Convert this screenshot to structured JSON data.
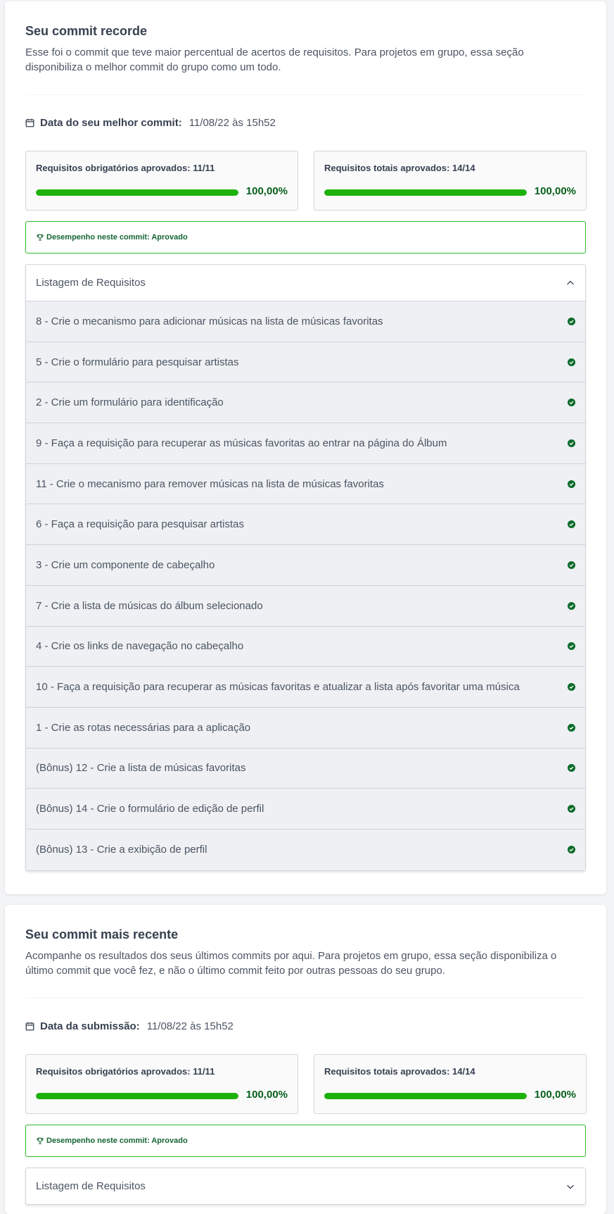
{
  "colors": {
    "progress": "#1db10b",
    "approved_border": "#2dbb27",
    "percent_text": "#065f1b",
    "check": "#0b6b2a"
  },
  "best_commit": {
    "title": "Seu commit recorde",
    "description": "Esse foi o commit que teve maior percentual de acertos de requisitos. Para projetos em grupo, essa seção disponibiliza o melhor commit do grupo como um todo.",
    "date_icon": "calendar-icon",
    "date_label": "Data do seu melhor commit:",
    "date_value": "11/08/22 às 15h52",
    "mandatory": {
      "label": "Requisitos obrigatórios aprovados: 11/11",
      "percent_text": "100,00%",
      "progress": 1.0
    },
    "total": {
      "label": "Requisitos totais aprovados: 14/14",
      "percent_text": "100,00%",
      "progress": 1.0
    },
    "performance_icon": "trophy-icon",
    "performance": "Desempenho neste commit: Aprovado",
    "requirements_header": "Listagem de Requisitos",
    "requirements_expanded": true,
    "requirements": [
      "8 - Crie o mecanismo para adicionar músicas na lista de músicas favoritas",
      "5 - Crie o formulário para pesquisar artistas",
      "2 - Crie um formulário para identificação",
      "9 - Faça a requisição para recuperar as músicas favoritas ao entrar na página do Álbum",
      "11 - Crie o mecanismo para remover músicas na lista de músicas favoritas",
      "6 - Faça a requisição para pesquisar artistas",
      "3 - Crie um componente de cabeçalho",
      "7 - Crie a lista de músicas do álbum selecionado",
      "4 - Crie os links de navegação no cabeçalho",
      "10 - Faça a requisição para recuperar as músicas favoritas e atualizar a lista após favoritar uma música",
      "1 - Crie as rotas necessárias para a aplicação",
      "(Bônus) 12 - Crie a lista de músicas favoritas",
      "(Bônus) 14 - Crie o formulário de edição de perfil",
      "(Bônus) 13 - Crie a exibição de perfil"
    ]
  },
  "latest_commit": {
    "title": "Seu commit mais recente",
    "description": "Acompanhe os resultados dos seus últimos commits por aqui. Para projetos em grupo, essa seção disponibiliza o último commit que você fez, e não o último commit feito por outras pessoas do seu grupo.",
    "date_icon": "calendar-icon",
    "date_label": "Data da submissão:",
    "date_value": "11/08/22 às 15h52",
    "mandatory": {
      "label": "Requisitos obrigatórios aprovados: 11/11",
      "percent_text": "100,00%",
      "progress": 1.0
    },
    "total": {
      "label": "Requisitos totais aprovados: 14/14",
      "percent_text": "100,00%",
      "progress": 1.0
    },
    "performance_icon": "trophy-icon",
    "performance": "Desempenho neste commit: Aprovado",
    "requirements_header": "Listagem de Requisitos",
    "requirements_expanded": false
  }
}
